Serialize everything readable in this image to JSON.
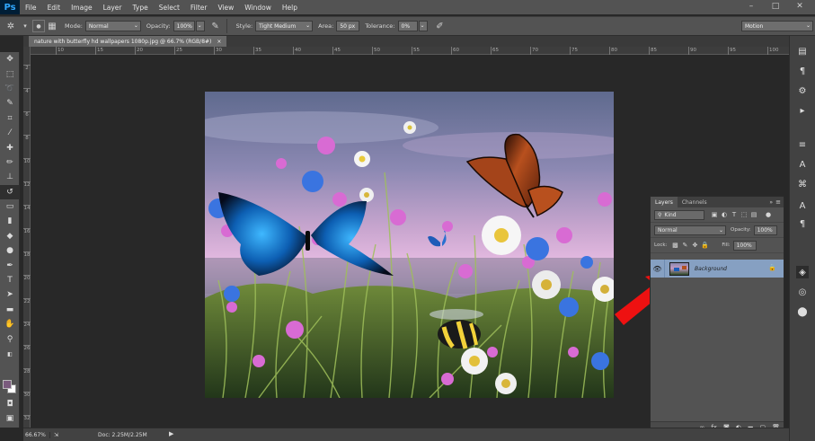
{
  "app": {
    "logo": "Ps"
  },
  "menu": [
    "File",
    "Edit",
    "Image",
    "Layer",
    "Type",
    "Select",
    "Filter",
    "View",
    "Window",
    "Help"
  ],
  "options": {
    "mode_label": "Mode:",
    "mode_value": "Normal",
    "opacity_label": "Opacity:",
    "opacity_value": "100%",
    "style_label": "Style:",
    "style_value": "Tight Medium",
    "area_label": "Area:",
    "area_value": "50 px",
    "tolerance_label": "Tolerance:",
    "tolerance_value": "0%",
    "workspace": "Motion"
  },
  "document": {
    "tab_title": "nature with butterfly hd wallpapers 1080p.jpg @ 66.7% (RGB/8#)"
  },
  "rulers": {
    "top": [
      "10",
      "15",
      "20",
      "25",
      "30",
      "35",
      "40",
      "45",
      "50",
      "55",
      "60",
      "65",
      "70",
      "75",
      "80",
      "85",
      "90",
      "95",
      "100"
    ],
    "left": [
      "2",
      "4",
      "6",
      "8",
      "10",
      "12",
      "14",
      "16",
      "18",
      "20",
      "22",
      "24",
      "26",
      "28",
      "30",
      "32"
    ]
  },
  "layers_panel": {
    "tabs": [
      "Layers",
      "Channels"
    ],
    "filter_value": "Kind",
    "blend_value": "Normal",
    "opacity_label": "Opacity:",
    "opacity_value": "100%",
    "lock_label": "Lock:",
    "fill_label": "Fill:",
    "fill_value": "100%",
    "layer_name": "Background"
  },
  "status": {
    "zoom": "66.67%",
    "doc_size": "Doc: 2.25M/2.25M"
  },
  "colors": {
    "foreground": "#7a5b7d",
    "background": "#ffffff",
    "selected_layer": "#86a0c2",
    "annotation_arrow": "#ee1111"
  }
}
